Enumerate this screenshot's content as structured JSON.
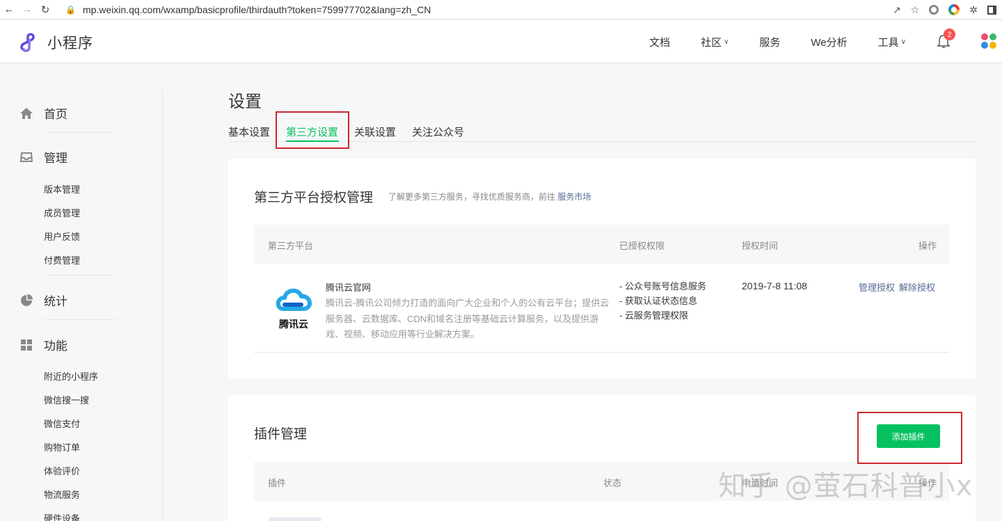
{
  "browser": {
    "url": "mp.weixin.qq.com/wxamp/basicprofile/thirdauth?token=759977702&lang=zh_CN"
  },
  "header": {
    "logo_text": "小程序",
    "nav": [
      {
        "label": "文档",
        "has_dropdown": false
      },
      {
        "label": "社区",
        "has_dropdown": true
      },
      {
        "label": "服务",
        "has_dropdown": false
      },
      {
        "label": "We分析",
        "has_dropdown": false
      },
      {
        "label": "工具",
        "has_dropdown": true
      }
    ],
    "notification_count": "2"
  },
  "sidebar": {
    "groups": [
      {
        "label": "首页",
        "icon": "home-icon"
      },
      {
        "label": "管理",
        "icon": "inbox-icon",
        "items": [
          "版本管理",
          "成员管理",
          "用户反馈",
          "付费管理"
        ]
      },
      {
        "label": "统计",
        "icon": "pie-chart-icon"
      },
      {
        "label": "功能",
        "icon": "grid-icon",
        "items": [
          "附近的小程序",
          "微信搜一搜",
          "微信支付",
          "购物订单",
          "体验评价",
          "物流服务",
          "硬件设备"
        ]
      }
    ]
  },
  "main": {
    "title": "设置",
    "tabs": [
      "基本设置",
      "第三方设置",
      "关联设置",
      "关注公众号"
    ],
    "active_tab": "第三方设置",
    "third_party": {
      "title": "第三方平台授权管理",
      "tip": "了解更多第三方服务，寻找优质服务商，前往",
      "tip_link": "服务市场",
      "columns": [
        "第三方平台",
        "已授权权限",
        "授权时间",
        "操作"
      ],
      "rows": [
        {
          "logo_text": "腾讯云",
          "name": "腾讯云官网",
          "description": "腾讯云-腾讯公司倾力打造的面向广大企业和个人的公有云平台；提供云服务器、云数据库、CDN和域名注册等基础云计算服务，以及提供游戏、视频、移动应用等行业解决方案。",
          "permissions": [
            "- 公众号账号信息服务",
            "- 获取认证状态信息",
            "- 云服务管理权限"
          ],
          "auth_time": "2019-7-8 11:08",
          "actions": [
            "管理授权",
            "解除授权"
          ]
        }
      ]
    },
    "plugins": {
      "title": "插件管理",
      "add_button": "添加插件",
      "columns": [
        "插件",
        "状态",
        "申请时间",
        "操作"
      ]
    }
  },
  "watermark": "知乎 @萤石科普小x",
  "colors": {
    "accent": "#07c160",
    "link": "#576b95",
    "highlight_box": "#c9282e",
    "badge": "#fa5151"
  }
}
